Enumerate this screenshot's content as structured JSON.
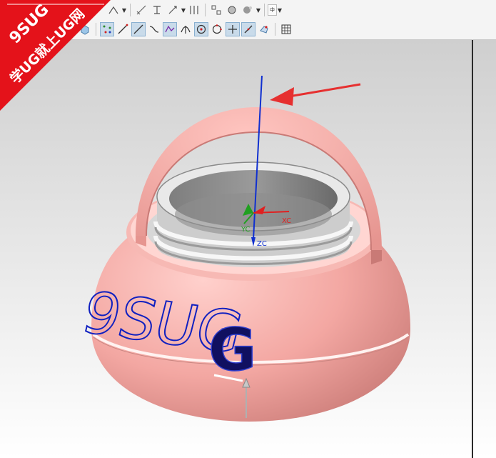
{
  "toolbar": {
    "language_label": "中",
    "row1_tools": [
      "sketch-tool",
      "dimension-tool",
      "constraint-tool",
      "edit-tool",
      "grid-tool",
      "snap-tool",
      "view-tool",
      "palette-tool"
    ],
    "row2_tools": [
      "block-tool",
      "point-tool",
      "line-tool",
      "curve-tool",
      "spline-tool",
      "intersect-tool",
      "circle-center-tool",
      "quadrant-tool",
      "cross-tool",
      "arc-tool",
      "view-triad-tool",
      "grid2-tool"
    ]
  },
  "badge": {
    "brand": "9SUG",
    "slogan": "学UG就上UG网",
    "color": "#e4121a"
  },
  "model": {
    "embossed_text": "9SUG",
    "emboss_letter": "G",
    "body_color": "#f3a7a2",
    "inner_color": "#cfcfcf"
  },
  "axes": {
    "xc_label": "XC",
    "yc_label": "YC",
    "zc_label": "ZC",
    "x_color": "#e02020",
    "y_color": "#20a020",
    "z_color": "#1030d0"
  },
  "annotation": {
    "arrow_color": "#e63030"
  }
}
